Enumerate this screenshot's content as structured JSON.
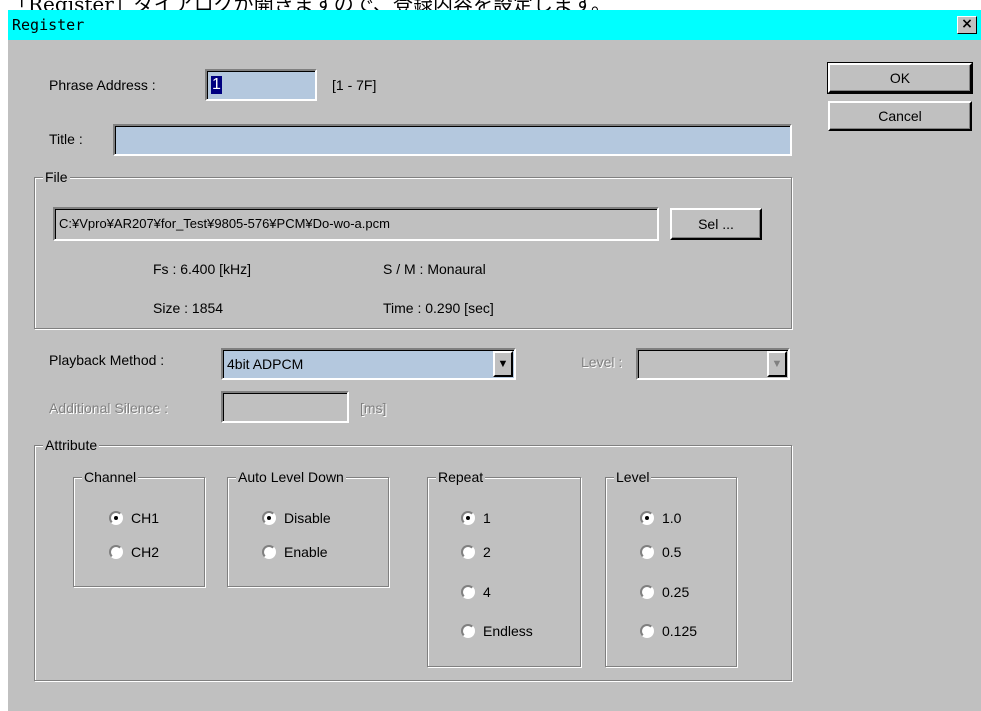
{
  "doc_caption": "「Register」ダイアログが開きますので、登録内容を設定します。",
  "dialog": {
    "title": "Register",
    "close_glyph": "×",
    "phrase_address": {
      "label": "Phrase Address :",
      "value": "1",
      "range": "[1 - 7F]"
    },
    "title_field": {
      "label": "Title :",
      "value": ""
    },
    "buttons": {
      "ok": "OK",
      "cancel": "Cancel",
      "select": "Sel ..."
    },
    "file": {
      "legend": "File",
      "path": "C:¥Vpro¥AR207¥for_Test¥9805-576¥PCM¥Do-wo-a.pcm",
      "fs": "Fs :  6.400 [kHz]",
      "sm": "S / M : Monaural",
      "size": "Size : 1854",
      "time": "Time :  0.290 [sec]"
    },
    "playback_method": {
      "label": "Playback Method :",
      "value": "4bit ADPCM"
    },
    "level_select": {
      "label": "Level :",
      "value": ""
    },
    "additional_silence": {
      "label": "Additional Silence :",
      "value": "",
      "unit": "[ms]"
    },
    "attribute": {
      "legend": "Attribute",
      "channel": {
        "legend": "Channel",
        "options": [
          "CH1",
          "CH2"
        ],
        "selected": "CH1"
      },
      "auto_level_down": {
        "legend": "Auto Level Down",
        "options": [
          "Disable",
          "Enable"
        ],
        "selected": "Disable"
      },
      "repeat": {
        "legend": "Repeat",
        "options": [
          "1",
          "2",
          "4",
          "Endless"
        ],
        "selected": "1"
      },
      "level": {
        "legend": "Level",
        "options": [
          "1.0",
          "0.5",
          "0.25",
          "0.125"
        ],
        "selected": "1.0"
      }
    }
  },
  "colors": {
    "titlebar": "#00ffff",
    "dialog_face": "#c0c0c0",
    "field_highlight": "#b4c8de"
  },
  "icons": {
    "close": "close-icon",
    "dropdown": "chevron-down-icon",
    "radio": "radio-button-icon"
  }
}
